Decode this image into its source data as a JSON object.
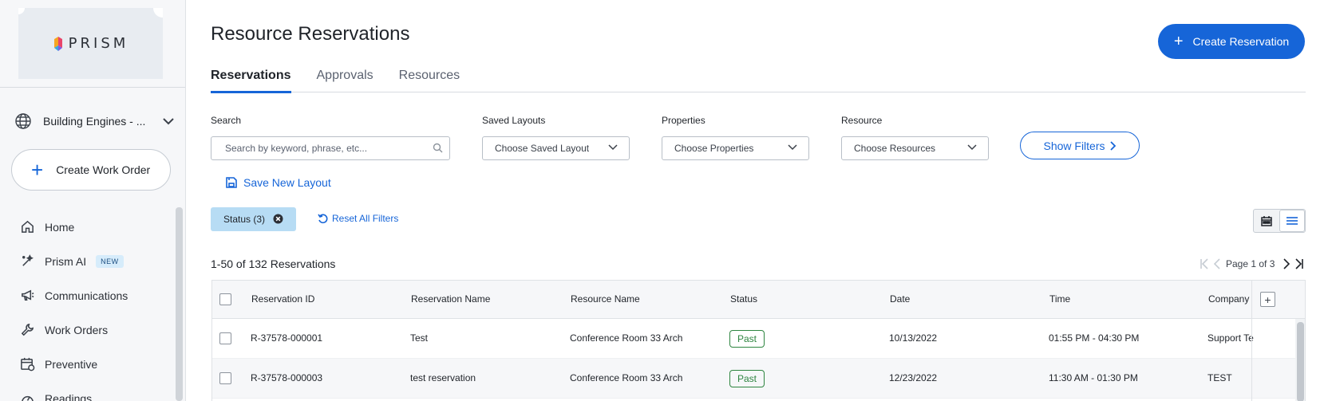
{
  "colors": {
    "accent": "#1665d8",
    "past_status": "#2e8540",
    "chip_bg": "#b7dcf4"
  },
  "brand": {
    "name": "PRISM"
  },
  "sidebar": {
    "org_name": "Building Engines - ...",
    "create_work_order": "Create Work Order",
    "items": [
      {
        "label": "Home",
        "icon": "home-icon"
      },
      {
        "label": "Prism AI",
        "icon": "magic-wand-icon",
        "badge": "NEW"
      },
      {
        "label": "Communications",
        "icon": "megaphone-icon"
      },
      {
        "label": "Work Orders",
        "icon": "wrench-icon"
      },
      {
        "label": "Preventive",
        "icon": "calendar-clock-icon"
      },
      {
        "label": "Readings",
        "icon": "gauge-icon"
      }
    ]
  },
  "page": {
    "title": "Resource Reservations",
    "create_button": "Create Reservation",
    "tabs": [
      {
        "label": "Reservations",
        "active": true
      },
      {
        "label": "Approvals",
        "active": false
      },
      {
        "label": "Resources",
        "active": false
      }
    ]
  },
  "filters": {
    "search_label": "Search",
    "search_placeholder": "Search by keyword, phrase, etc...",
    "saved_layouts_label": "Saved Layouts",
    "saved_layouts_value": "Choose Saved Layout",
    "properties_label": "Properties",
    "properties_value": "Choose Properties",
    "resource_label": "Resource",
    "resource_value": "Choose Resources",
    "show_filters": "Show Filters",
    "save_layout": "Save New Layout",
    "status_chip": "Status (3)",
    "reset_filters": "Reset All Filters"
  },
  "results": {
    "count_text": "1-50 of 132 Reservations",
    "page_text": "Page 1 of 3"
  },
  "table": {
    "columns": [
      "Reservation ID",
      "Reservation Name",
      "Resource Name",
      "Status",
      "Date",
      "Time",
      "Company"
    ],
    "rows": [
      [
        "R-37578-000001",
        "Test",
        "Conference Room 33 Arch",
        "Past",
        "10/13/2022",
        "01:55 PM - 04:30 PM",
        "Support Te"
      ],
      [
        "R-37578-000003",
        "test reservation",
        "Conference Room 33 Arch",
        "Past",
        "12/23/2022",
        "11:30 AM - 01:30 PM",
        "TEST"
      ]
    ]
  }
}
